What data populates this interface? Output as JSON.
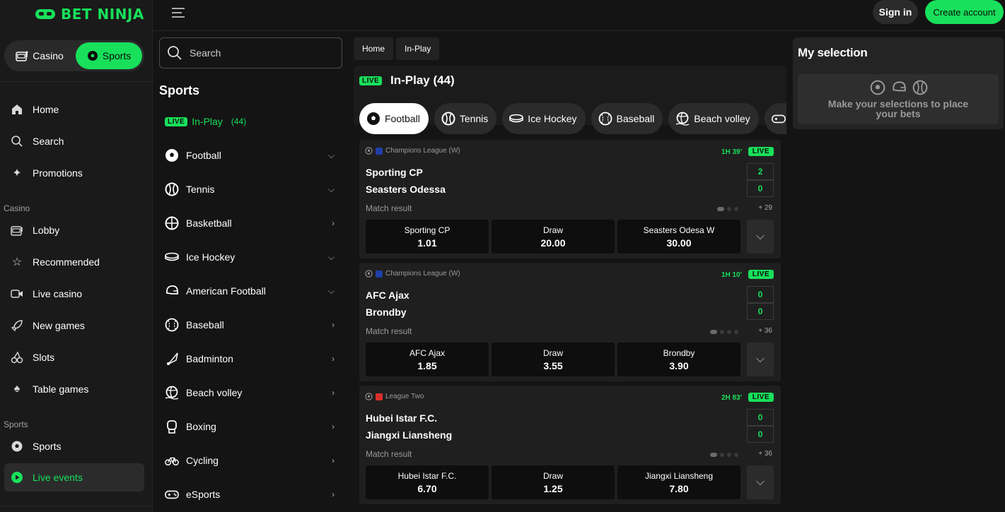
{
  "brand": {
    "name": "BET NINJA"
  },
  "mode_switch": {
    "casino": "Casino",
    "sports": "Sports"
  },
  "nav": {
    "items_top": [
      "Home",
      "Search",
      "Promotions"
    ],
    "casino_section": "Casino",
    "casino_items": [
      "Lobby",
      "Recommended",
      "Live casino",
      "New games",
      "Slots",
      "Table games"
    ],
    "sports_section": "Sports",
    "sports_items": [
      "Sports",
      "Live events"
    ]
  },
  "header": {
    "signin": "Sign in",
    "create": "Create account"
  },
  "sidebar": {
    "search_placeholder": "Search",
    "title": "Sports",
    "live_badge": "LIVE",
    "inplay_label": "In-Play",
    "inplay_count": "(44)",
    "sports": [
      "Football",
      "Tennis",
      "Basketball",
      "Ice Hockey",
      "American Football",
      "Baseball",
      "Badminton",
      "Beach volley",
      "Boxing",
      "Cycling",
      "eSports"
    ]
  },
  "breadcrumb": {
    "home": "Home",
    "current": "In-Play"
  },
  "inplay": {
    "live_badge": "LIVE",
    "title": "In-Play (44)"
  },
  "tabs": [
    "Football",
    "Tennis",
    "Ice Hockey",
    "Baseball",
    "Beach volley",
    "eSports"
  ],
  "matches": [
    {
      "competition": "Champions League (W)",
      "flag_color": "#1f3fa8",
      "time": "1H 39'",
      "live": "LIVE",
      "home": "Sporting CP",
      "away": "Seasters Odessa",
      "home_score": "2",
      "away_score": "0",
      "market": "Match result",
      "more": "+ 29",
      "odds": [
        {
          "label": "Sporting CP",
          "value": "1.01"
        },
        {
          "label": "Draw",
          "value": "20.00"
        },
        {
          "label": "Seasters Odesa W",
          "value": "30.00"
        }
      ]
    },
    {
      "competition": "Champions League (W)",
      "flag_color": "#1f3fa8",
      "time": "1H 10'",
      "live": "LIVE",
      "home": "AFC Ajax",
      "away": "Brondby",
      "home_score": "0",
      "away_score": "0",
      "market": "Match result",
      "more": "+ 36",
      "odds": [
        {
          "label": "AFC Ajax",
          "value": "1.85"
        },
        {
          "label": "Draw",
          "value": "3.55"
        },
        {
          "label": "Brondby",
          "value": "3.90"
        }
      ]
    },
    {
      "competition": "League Two",
      "flag_color": "#d9302c",
      "time": "2H 83'",
      "live": "LIVE",
      "home": "Hubei Istar F.C.",
      "away": "Jiangxi Liansheng",
      "home_score": "0",
      "away_score": "0",
      "market": "Match result",
      "more": "+ 36",
      "odds": [
        {
          "label": "Hubei Istar F.C.",
          "value": "6.70"
        },
        {
          "label": "Draw",
          "value": "1.25"
        },
        {
          "label": "Jiangxi Liansheng",
          "value": "7.80"
        }
      ]
    }
  ],
  "selection": {
    "title": "My selection",
    "empty_text_line1": "Make your selections to place",
    "empty_text_line2": "your bets"
  },
  "colors": {
    "accent": "#18e05b",
    "bg": "#141414",
    "panel": "#1f1f1f"
  }
}
